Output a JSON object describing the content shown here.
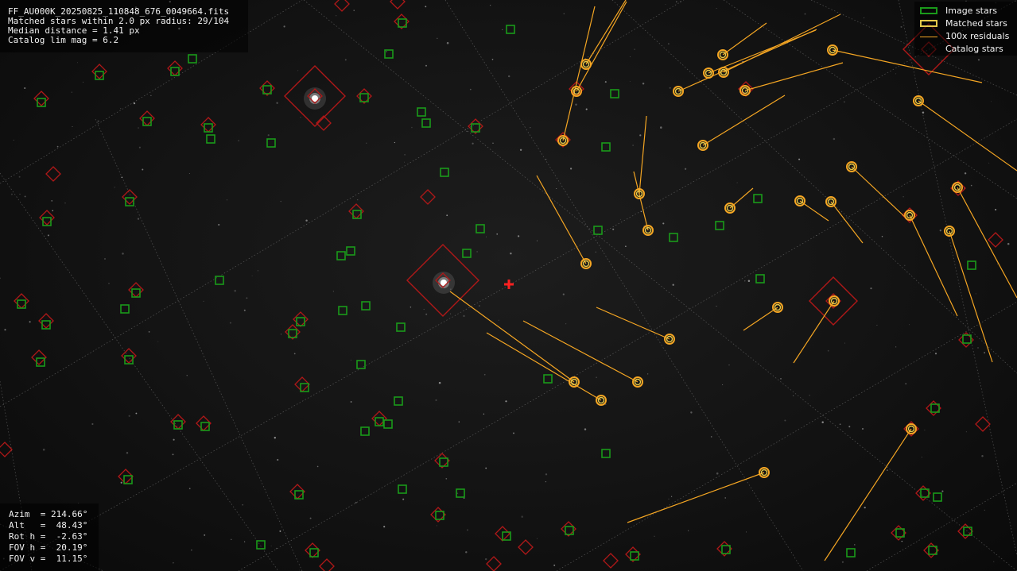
{
  "info": {
    "filename": "FF_AU000K_20250825_110848_676_0049664.fits",
    "matched_line": "Matched stars within 2.0 px radius: 29/104",
    "median_line": "Median distance = 1.41 px",
    "catalog_line": "Catalog lim mag = 6.2"
  },
  "pointing": {
    "azim": "Azim  = 214.66°",
    "alt": "Alt   =  48.43°",
    "rot": "Rot h =  -2.63°",
    "fov_h": "FOV h =  20.19°",
    "fov_v": "FOV v =  11.15°"
  },
  "legend": {
    "image_stars": "Image stars",
    "matched_stars": "Matched stars",
    "residuals": "100x residuals",
    "catalog_stars": "Catalog stars"
  },
  "colors": {
    "image_star": "#1a9a1a",
    "matched_star": "#e3c84a",
    "residual": "#f5a623",
    "catalog_star": "#b01818",
    "center_marker": "#ff2020"
  },
  "stars": {
    "bright": [
      [
        396,
        124
      ],
      [
        558,
        356
      ]
    ],
    "image": [
      [
        642,
        37
      ],
      [
        489,
        68
      ],
      [
        242,
        74
      ],
      [
        506,
        29
      ],
      [
        336,
        113
      ],
      [
        458,
        123
      ],
      [
        125,
        95
      ],
      [
        220,
        90
      ],
      [
        52,
        129
      ],
      [
        185,
        153
      ],
      [
        262,
        161
      ],
      [
        265,
        175
      ],
      [
        341,
        180
      ],
      [
        530,
        141
      ],
      [
        536,
        155
      ],
      [
        598,
        161
      ],
      [
        559,
        217
      ],
      [
        163,
        254
      ],
      [
        59,
        279
      ],
      [
        449,
        270
      ],
      [
        604,
        288
      ],
      [
        587,
        319
      ],
      [
        441,
        316
      ],
      [
        429,
        322
      ],
      [
        276,
        353
      ],
      [
        171,
        369
      ],
      [
        27,
        383
      ],
      [
        157,
        389
      ],
      [
        431,
        391
      ],
      [
        460,
        385
      ],
      [
        58,
        409
      ],
      [
        378,
        405
      ],
      [
        368,
        420
      ],
      [
        504,
        412
      ],
      [
        162,
        453
      ],
      [
        51,
        456
      ],
      [
        454,
        459
      ],
      [
        383,
        488
      ],
      [
        501,
        505
      ],
      [
        224,
        535
      ],
      [
        258,
        537
      ],
      [
        477,
        531
      ],
      [
        488,
        534
      ],
      [
        459,
        543
      ],
      [
        558,
        582
      ],
      [
        161,
        604
      ],
      [
        376,
        623
      ],
      [
        506,
        616
      ],
      [
        579,
        621
      ],
      [
        553,
        649
      ],
      [
        637,
        675
      ],
      [
        716,
        668
      ],
      [
        328,
        686
      ],
      [
        395,
        696
      ],
      [
        798,
        700
      ],
      [
        913,
        692
      ],
      [
        762,
        571
      ],
      [
        689,
        477
      ],
      [
        773,
        118
      ],
      [
        762,
        185
      ],
      [
        752,
        290
      ],
      [
        847,
        299
      ],
      [
        905,
        284
      ],
      [
        953,
        250
      ],
      [
        956,
        351
      ],
      [
        1222,
        334
      ],
      [
        1216,
        427
      ],
      [
        1176,
        514
      ],
      [
        1163,
        621
      ],
      [
        1179,
        626
      ],
      [
        1132,
        671
      ],
      [
        1217,
        669
      ],
      [
        1173,
        693
      ],
      [
        1070,
        696
      ]
    ],
    "catalog": [
      [
        430,
        5
      ],
      [
        500,
        2
      ],
      [
        505,
        27
      ],
      [
        396,
        121
      ],
      [
        407,
        155
      ],
      [
        336,
        111
      ],
      [
        458,
        121
      ],
      [
        125,
        90
      ],
      [
        220,
        86
      ],
      [
        52,
        124
      ],
      [
        185,
        149
      ],
      [
        262,
        157
      ],
      [
        67,
        219
      ],
      [
        163,
        248
      ],
      [
        59,
        274
      ],
      [
        448,
        266
      ],
      [
        538,
        248
      ],
      [
        598,
        159
      ],
      [
        557,
        353
      ],
      [
        171,
        365
      ],
      [
        27,
        379
      ],
      [
        58,
        404
      ],
      [
        378,
        402
      ],
      [
        368,
        418
      ],
      [
        162,
        448
      ],
      [
        49,
        450
      ],
      [
        380,
        484
      ],
      [
        224,
        531
      ],
      [
        256,
        533
      ],
      [
        477,
        527
      ],
      [
        6,
        566
      ],
      [
        158,
        600
      ],
      [
        556,
        580
      ],
      [
        374,
        619
      ],
      [
        551,
        648
      ],
      [
        632,
        672
      ],
      [
        661,
        689
      ],
      [
        621,
        710
      ],
      [
        411,
        713
      ],
      [
        393,
        693
      ],
      [
        715,
        666
      ],
      [
        768,
        706
      ],
      [
        796,
        698
      ],
      [
        911,
        691
      ],
      [
        725,
        112
      ],
      [
        708,
        176
      ],
      [
        938,
        112
      ],
      [
        1144,
        271
      ],
      [
        1048,
        379
      ],
      [
        1168,
        62
      ],
      [
        1205,
        237
      ],
      [
        1252,
        302
      ],
      [
        1215,
        428
      ],
      [
        1174,
        514
      ],
      [
        1236,
        534
      ],
      [
        1146,
        540
      ],
      [
        1161,
        621
      ],
      [
        1130,
        671
      ],
      [
        1214,
        669
      ],
      [
        1171,
        693
      ]
    ],
    "big_catalog": [
      [
        396,
        121
      ],
      [
        557,
        353
      ],
      [
        1048,
        379
      ],
      [
        1168,
        62
      ]
    ]
  },
  "matched": [
    {
      "p": [
        737,
        81
      ],
      "r": [
        787,
        0
      ]
    },
    {
      "p": [
        725,
        115
      ],
      "r": [
        788,
        2
      ]
    },
    {
      "p": [
        708,
        177
      ],
      "r": [
        748,
        8
      ]
    },
    {
      "p": [
        909,
        69
      ],
      "r": [
        964,
        29
      ]
    },
    {
      "p": [
        891,
        92
      ],
      "r": [
        1026,
        38
      ]
    },
    {
      "p": [
        910,
        91
      ],
      "r": [
        1057,
        18
      ]
    },
    {
      "p": [
        853,
        115
      ],
      "r": [
        1027,
        37
      ]
    },
    {
      "p": [
        937,
        114
      ],
      "r": [
        1060,
        79
      ]
    },
    {
      "p": [
        1047,
        63
      ],
      "r": [
        1235,
        104
      ]
    },
    {
      "p": [
        1155,
        127
      ],
      "r": [
        1279,
        215
      ]
    },
    {
      "p": [
        884,
        183
      ],
      "r": [
        987,
        120
      ]
    },
    {
      "p": [
        1071,
        210
      ],
      "r": [
        1140,
        275
      ]
    },
    {
      "p": [
        1204,
        236
      ],
      "r": [
        1279,
        375
      ]
    },
    {
      "p": [
        1144,
        271
      ],
      "r": [
        1204,
        398
      ]
    },
    {
      "p": [
        1194,
        291
      ],
      "r": [
        1248,
        456
      ]
    },
    {
      "p": [
        1006,
        253
      ],
      "r": [
        1042,
        278
      ]
    },
    {
      "p": [
        1045,
        254
      ],
      "r": [
        1085,
        306
      ]
    },
    {
      "p": [
        918,
        262
      ],
      "r": [
        947,
        237
      ]
    },
    {
      "p": [
        804,
        244
      ],
      "r": [
        813,
        146
      ]
    },
    {
      "p": [
        815,
        290
      ],
      "r": [
        797,
        216
      ]
    },
    {
      "p": [
        737,
        332
      ],
      "r": [
        675,
        221
      ]
    },
    {
      "p": [
        842,
        427
      ],
      "r": [
        750,
        387
      ]
    },
    {
      "p": [
        978,
        387
      ],
      "r": [
        935,
        416
      ]
    },
    {
      "p": [
        1049,
        379
      ],
      "r": [
        998,
        457
      ]
    },
    {
      "p": [
        722,
        481
      ],
      "r": [
        566,
        367
      ]
    },
    {
      "p": [
        802,
        481
      ],
      "r": [
        658,
        404
      ]
    },
    {
      "p": [
        756,
        504
      ],
      "r": [
        612,
        419
      ]
    },
    {
      "p": [
        961,
        595
      ],
      "r": [
        789,
        658
      ]
    },
    {
      "p": [
        1146,
        540
      ],
      "r": [
        1037,
        706
      ]
    }
  ],
  "grid": [
    [
      [
        0,
        231
      ],
      [
        380,
        0
      ]
    ],
    [
      [
        0,
        512
      ],
      [
        860,
        0
      ]
    ],
    [
      [
        0,
        719
      ],
      [
        1279,
        0
      ]
    ],
    [
      [
        300,
        719
      ],
      [
        1279,
        150
      ]
    ],
    [
      [
        700,
        719
      ],
      [
        1279,
        380
      ]
    ],
    [
      [
        1090,
        719
      ],
      [
        1279,
        608
      ]
    ],
    [
      [
        382,
        0
      ],
      [
        1279,
        719
      ]
    ],
    [
      [
        0,
        218
      ],
      [
        350,
        719
      ]
    ],
    [
      [
        0,
        660
      ],
      [
        130,
        719
      ]
    ],
    [
      [
        560,
        0
      ],
      [
        1010,
        719
      ]
    ],
    [
      [
        770,
        0
      ],
      [
        1279,
        470
      ]
    ],
    [
      [
        910,
        0
      ],
      [
        1279,
        250
      ]
    ],
    [
      [
        1020,
        0
      ],
      [
        1279,
        120
      ]
    ],
    [
      [
        1130,
        0
      ],
      [
        1279,
        700
      ]
    ],
    [
      [
        120,
        150
      ],
      [
        380,
        719
      ]
    ],
    [
      [
        0,
        480
      ],
      [
        40,
        719
      ]
    ]
  ],
  "center": [
    640,
    358
  ]
}
